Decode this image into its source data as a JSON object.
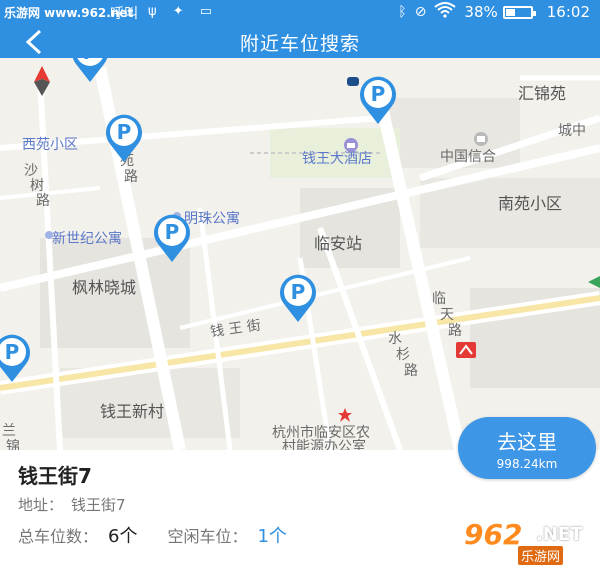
{
  "statusbar": {
    "watermark": "乐游网 www.962.net",
    "carrier": "呼叫",
    "battery_percent": "38%",
    "battery_level": 0.38,
    "time": "16:02"
  },
  "appbar": {
    "back": "<",
    "title": "附近车位搜索"
  },
  "map": {
    "labels": [
      {
        "text": "汇锦苑",
        "style": "big"
      },
      {
        "text": "西苑小区",
        "style": "blue"
      },
      {
        "text": "沙",
        "style": ""
      },
      {
        "text": "树",
        "style": ""
      },
      {
        "text": "路",
        "style": ""
      },
      {
        "text": "西",
        "style": ""
      },
      {
        "text": "苑",
        "style": ""
      },
      {
        "text": "路",
        "style": ""
      },
      {
        "text": "钱王大酒店",
        "style": "blue"
      },
      {
        "text": "中国信合",
        "style": ""
      },
      {
        "text": "城中",
        "style": ""
      },
      {
        "text": "南苑小区",
        "style": "big"
      },
      {
        "text": "明珠公寓",
        "style": "blue"
      },
      {
        "text": "新世纪公寓",
        "style": "blue"
      },
      {
        "text": "临安站",
        "style": "big"
      },
      {
        "text": "枫林晓城",
        "style": "big"
      },
      {
        "text": "临",
        "style": ""
      },
      {
        "text": "天",
        "style": ""
      },
      {
        "text": "路",
        "style": ""
      },
      {
        "text": "钱 王 街",
        "style": ""
      },
      {
        "text": "水",
        "style": ""
      },
      {
        "text": "杉",
        "style": ""
      },
      {
        "text": "路",
        "style": ""
      },
      {
        "text": "钱王新村",
        "style": "big"
      },
      {
        "text": "杭州市临安区农",
        "style": ""
      },
      {
        "text": "村能源办公室",
        "style": ""
      },
      {
        "text": "兰",
        "style": ""
      },
      {
        "text": "锦",
        "style": ""
      }
    ],
    "pin_letter": "P"
  },
  "info": {
    "name": "钱王街7",
    "address_label": "地址：",
    "address": "钱王街7",
    "total_label": "总车位数：",
    "total_value": "6个",
    "free_label": "空闲车位：",
    "free_value": "1个"
  },
  "goto": {
    "label": "去这里",
    "distance": "998.24km"
  },
  "logo": {
    "num": "962",
    "net": ".NET",
    "cn": "乐游网"
  },
  "colors": {
    "accent": "#2f8fe0",
    "pin_blue": "#2f8fe0",
    "metro_red": "#e53935"
  }
}
